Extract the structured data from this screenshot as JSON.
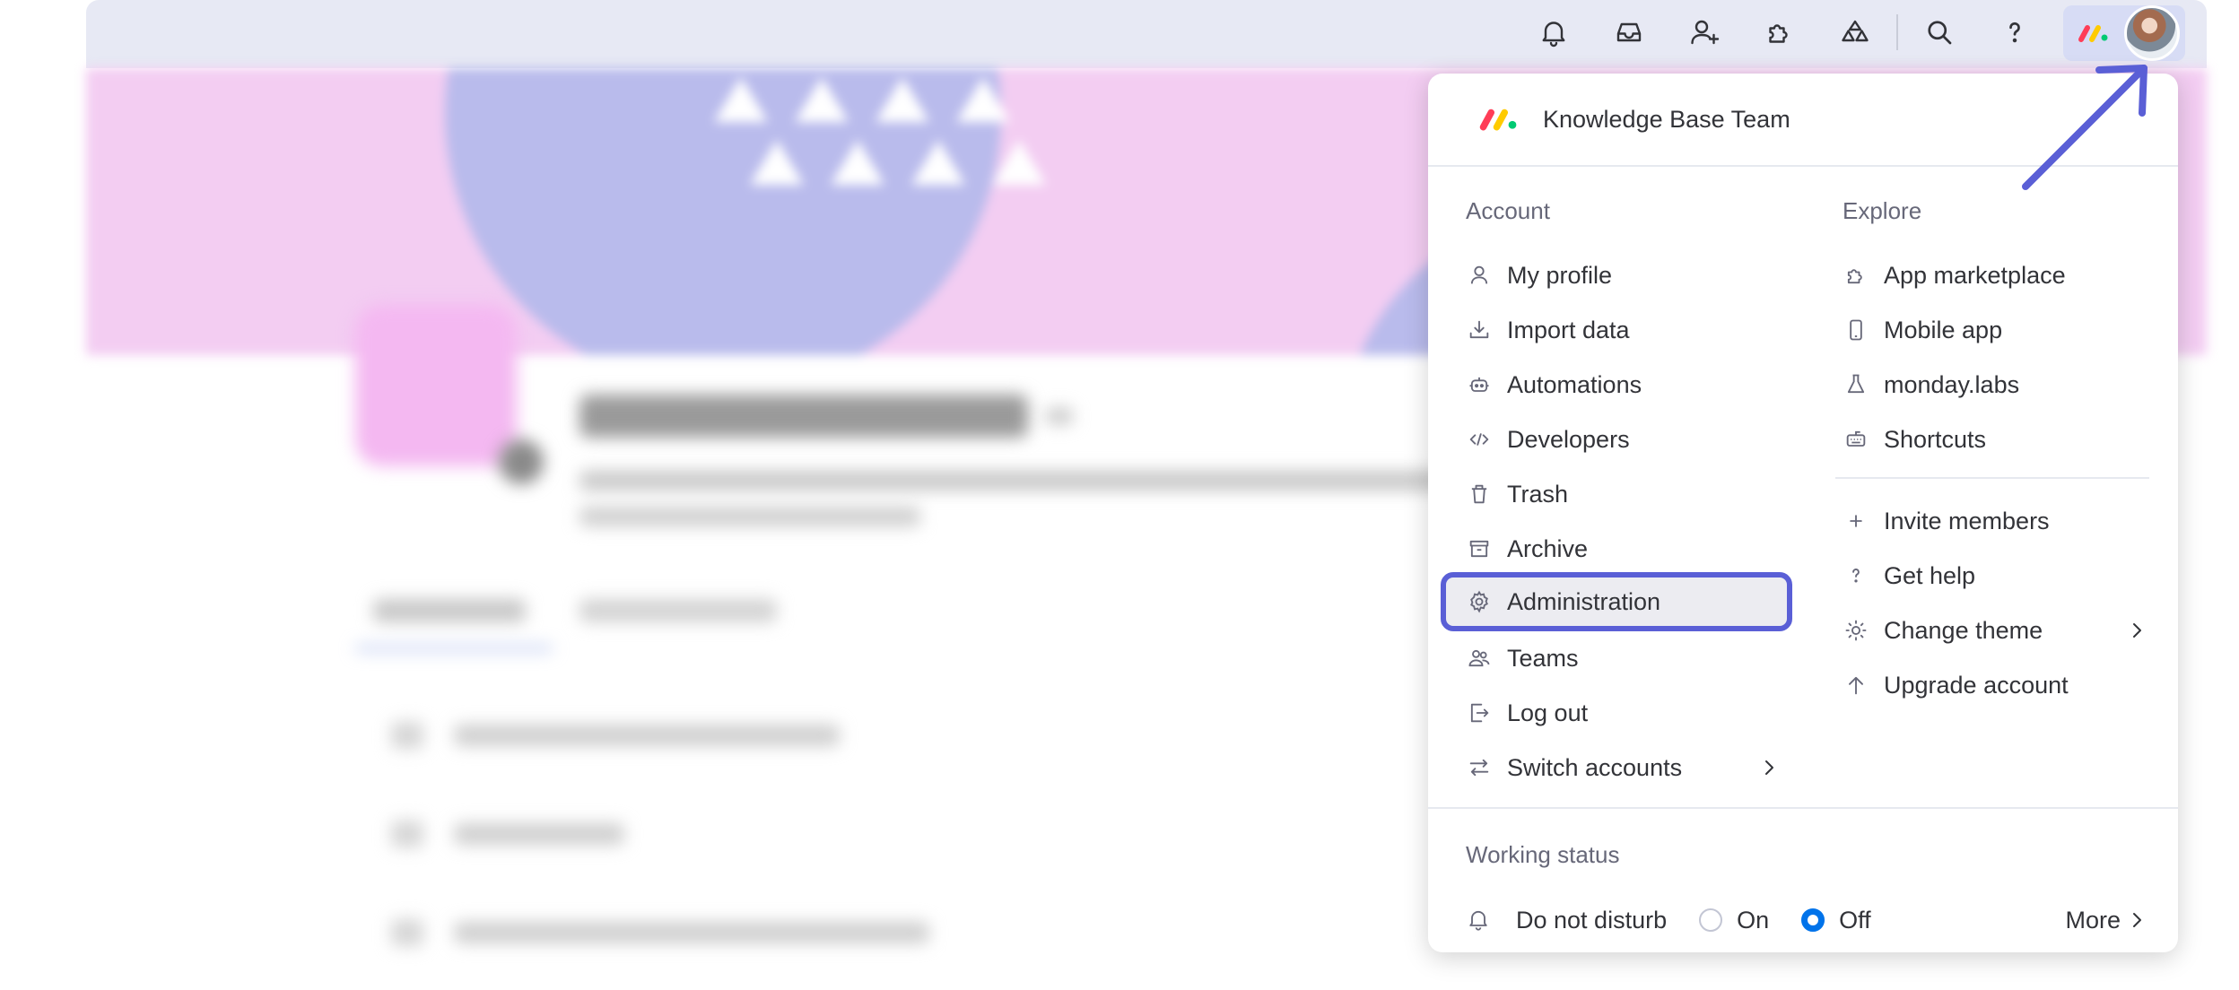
{
  "topbar": {
    "icons": [
      "bell-icon",
      "inbox-icon",
      "invite-member-icon",
      "apps-icon",
      "integrations-icon",
      "search-icon",
      "help-icon"
    ]
  },
  "menu": {
    "team_name": "Knowledge Base Team",
    "account": {
      "title": "Account",
      "items": [
        {
          "label": "My profile",
          "icon": "person-icon"
        },
        {
          "label": "Import data",
          "icon": "download-icon"
        },
        {
          "label": "Automations",
          "icon": "robot-icon"
        },
        {
          "label": "Developers",
          "icon": "code-icon"
        },
        {
          "label": "Trash",
          "icon": "trash-icon"
        },
        {
          "label": "Archive",
          "icon": "archive-icon"
        },
        {
          "label": "Administration",
          "icon": "gear-icon"
        },
        {
          "label": "Teams",
          "icon": "teams-icon"
        },
        {
          "label": "Log out",
          "icon": "logout-icon"
        },
        {
          "label": "Switch accounts",
          "icon": "switch-icon"
        }
      ]
    },
    "explore": {
      "title": "Explore",
      "items": [
        {
          "label": "App marketplace",
          "icon": "puzzle-icon"
        },
        {
          "label": "Mobile app",
          "icon": "phone-icon"
        },
        {
          "label": "monday.labs",
          "icon": "flask-icon"
        },
        {
          "label": "Shortcuts",
          "icon": "keyboard-icon"
        },
        {
          "label": "Invite members",
          "icon": "plus-icon"
        },
        {
          "label": "Get help",
          "icon": "question-icon"
        },
        {
          "label": "Change theme",
          "icon": "sun-icon"
        },
        {
          "label": "Upgrade account",
          "icon": "arrow-up-icon"
        }
      ]
    },
    "working_status": {
      "title": "Working status",
      "do_not_disturb": "Do not disturb",
      "on_label": "On",
      "off_label": "Off",
      "selected": "Off",
      "more_label": "More"
    }
  },
  "colors": {
    "highlight": "#5a5fd6",
    "radio_selected": "#0073ea",
    "topbar_bg": "#e7e9f4",
    "banner": "#f3cdf2"
  }
}
